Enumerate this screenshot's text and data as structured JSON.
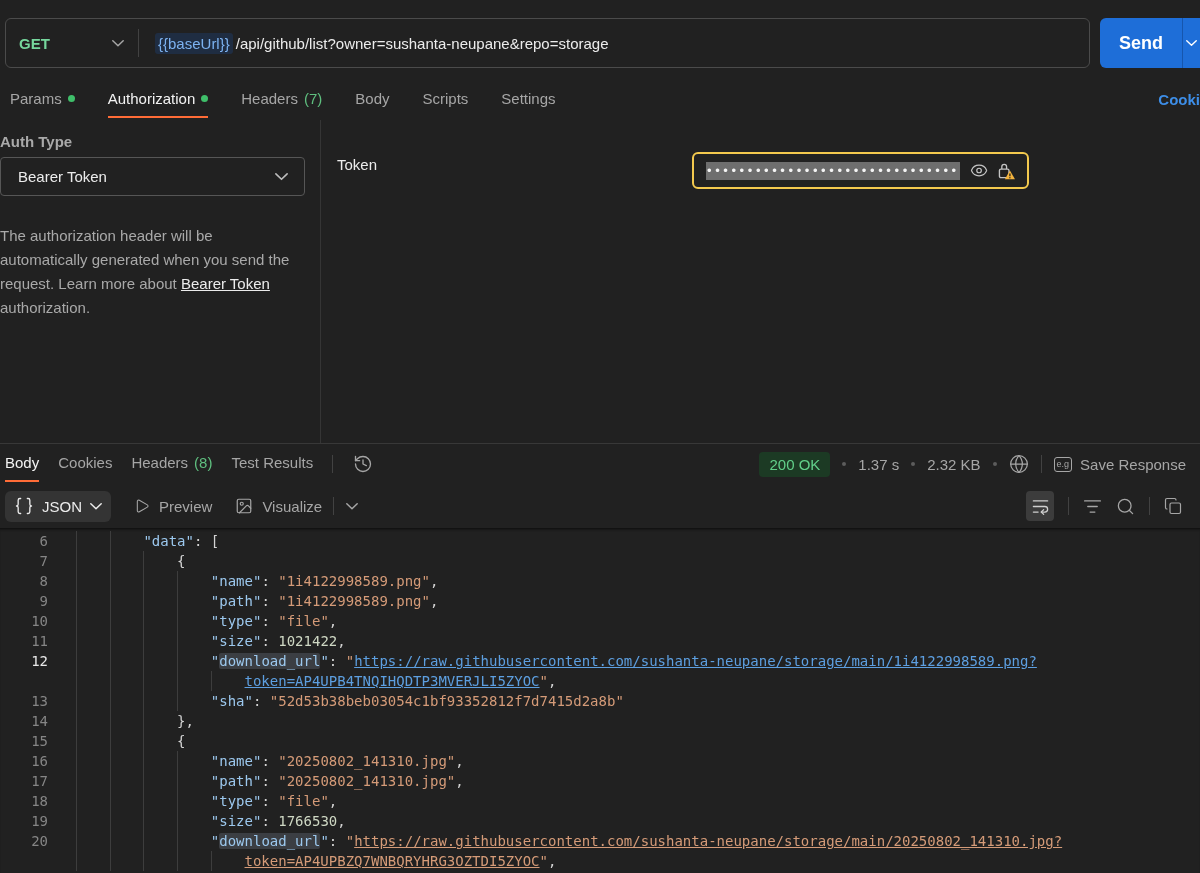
{
  "request": {
    "method": "GET",
    "url_variable": "{{baseUrl}}",
    "url_path": "/api/github/list?owner=sushanta-neupane&repo=storage",
    "send_label": "Send"
  },
  "request_tabs": [
    {
      "label": "Params",
      "dot": true,
      "selected": false
    },
    {
      "label": "Authorization",
      "dot": true,
      "selected": true
    },
    {
      "label": "Headers",
      "count": "(7)",
      "dot": false,
      "selected": false
    },
    {
      "label": "Body",
      "dot": false,
      "selected": false
    },
    {
      "label": "Scripts",
      "dot": false,
      "selected": false
    },
    {
      "label": "Settings",
      "dot": false,
      "selected": false
    }
  ],
  "cookies_link": "Cooki",
  "auth": {
    "type_label": "Auth Type",
    "type_value": "Bearer Token",
    "description_start": "The authorization header will be automatically generated when you send the request. Learn more about",
    "description_link": "Bearer Token",
    "description_end": "authorization."
  },
  "token": {
    "label": "Token",
    "value": "•••••••••••••••••••••••••••••••",
    "selected": true,
    "warning": true
  },
  "response_tabs": [
    {
      "label": "Body",
      "selected": true
    },
    {
      "label": "Cookies",
      "selected": false
    },
    {
      "label": "Headers",
      "count": "(8)",
      "selected": false
    },
    {
      "label": "Test Results",
      "selected": false
    }
  ],
  "response_status": {
    "status": "200 OK",
    "kind": "success",
    "time": "1.37 s",
    "size": "2.32 KB",
    "save_tag": "e.g",
    "save_label": "Save Response"
  },
  "body_view": {
    "format": "JSON",
    "views": [
      {
        "label": "Preview",
        "kind": "preview"
      },
      {
        "label": "Visualize",
        "kind": "visualize"
      }
    ],
    "wrap_on": true
  },
  "code": {
    "lines": [
      {
        "number": "6",
        "current": false,
        "tokens": [
          {
            "kind": "key",
            "text": "\"data\"",
            "highlighted": false
          },
          {
            "kind": "punct",
            "text": ": ["
          }
        ],
        "children": [
          {
            "number": "7",
            "current": false,
            "tokens": [
              {
                "kind": "punct",
                "text": "{"
              }
            ],
            "children": [
              {
                "number": "8",
                "current": false,
                "tokens": [
                  {
                    "kind": "key",
                    "text": "\"name\"",
                    "highlighted": false
                  },
                  {
                    "kind": "punct",
                    "text": ": "
                  },
                  {
                    "kind": "string",
                    "text": "\"1i4122998589.png\""
                  },
                  {
                    "kind": "punct",
                    "text": ","
                  }
                ]
              },
              {
                "number": "9",
                "current": false,
                "tokens": [
                  {
                    "kind": "key",
                    "text": "\"path\"",
                    "highlighted": false
                  },
                  {
                    "kind": "punct",
                    "text": ": "
                  },
                  {
                    "kind": "string",
                    "text": "\"1i4122998589.png\""
                  },
                  {
                    "kind": "punct",
                    "text": ","
                  }
                ]
              },
              {
                "number": "10",
                "current": false,
                "tokens": [
                  {
                    "kind": "key",
                    "text": "\"type\"",
                    "highlighted": false
                  },
                  {
                    "kind": "punct",
                    "text": ": "
                  },
                  {
                    "kind": "string",
                    "text": "\"file\""
                  },
                  {
                    "kind": "punct",
                    "text": ","
                  }
                ]
              },
              {
                "number": "11",
                "current": false,
                "tokens": [
                  {
                    "kind": "key",
                    "text": "\"size\"",
                    "highlighted": false
                  },
                  {
                    "kind": "punct",
                    "text": ": "
                  },
                  {
                    "kind": "number",
                    "text": "1021422"
                  },
                  {
                    "kind": "punct",
                    "text": ","
                  }
                ]
              },
              {
                "number": "12",
                "current": true,
                "tokens": [
                  {
                    "kind": "key",
                    "text": "\"",
                    "highlighted": false
                  },
                  {
                    "kind": "key",
                    "text": "download_url",
                    "highlighted": true
                  },
                  {
                    "kind": "key",
                    "text": "\"",
                    "highlighted": false
                  },
                  {
                    "kind": "punct",
                    "text": ": "
                  },
                  {
                    "kind": "string",
                    "text": "\""
                  },
                  {
                    "kind": "link",
                    "text": "https://raw.githubusercontent.com/sushanta-neupane/storage/main/1i4122998589.png?",
                    "hovered": true
                  }
                ],
                "continuation": [
                  {
                    "kind": "link",
                    "text": "token=AP4UPB4TNQIHQDTP3MVERJLI5ZYOC",
                    "hovered": true
                  },
                  {
                    "kind": "string",
                    "text": "\""
                  },
                  {
                    "kind": "punct",
                    "text": ","
                  }
                ]
              },
              {
                "number": "13",
                "current": false,
                "tokens": [
                  {
                    "kind": "key",
                    "text": "\"sha\"",
                    "highlighted": false
                  },
                  {
                    "kind": "punct",
                    "text": ": "
                  },
                  {
                    "kind": "string",
                    "text": "\"52d53b38beb03054c1bf93352812f7d7415d2a8b\""
                  }
                ]
              }
            ]
          },
          {
            "number": "14",
            "current": false,
            "tokens": [
              {
                "kind": "punct",
                "text": "},"
              }
            ]
          },
          {
            "number": "15",
            "current": false,
            "tokens": [
              {
                "kind": "punct",
                "text": "{"
              }
            ],
            "children": [
              {
                "number": "16",
                "current": false,
                "tokens": [
                  {
                    "kind": "key",
                    "text": "\"name\"",
                    "highlighted": false
                  },
                  {
                    "kind": "punct",
                    "text": ": "
                  },
                  {
                    "kind": "string",
                    "text": "\"20250802_141310.jpg\""
                  },
                  {
                    "kind": "punct",
                    "text": ","
                  }
                ]
              },
              {
                "number": "17",
                "current": false,
                "tokens": [
                  {
                    "kind": "key",
                    "text": "\"path\"",
                    "highlighted": false
                  },
                  {
                    "kind": "punct",
                    "text": ": "
                  },
                  {
                    "kind": "string",
                    "text": "\"20250802_141310.jpg\""
                  },
                  {
                    "kind": "punct",
                    "text": ","
                  }
                ]
              },
              {
                "number": "18",
                "current": false,
                "tokens": [
                  {
                    "kind": "key",
                    "text": "\"type\"",
                    "highlighted": false
                  },
                  {
                    "kind": "punct",
                    "text": ": "
                  },
                  {
                    "kind": "string",
                    "text": "\"file\""
                  },
                  {
                    "kind": "punct",
                    "text": ","
                  }
                ]
              },
              {
                "number": "19",
                "current": false,
                "tokens": [
                  {
                    "kind": "key",
                    "text": "\"size\"",
                    "highlighted": false
                  },
                  {
                    "kind": "punct",
                    "text": ": "
                  },
                  {
                    "kind": "number",
                    "text": "1766530"
                  },
                  {
                    "kind": "punct",
                    "text": ","
                  }
                ]
              },
              {
                "number": "20",
                "current": false,
                "tokens": [
                  {
                    "kind": "key",
                    "text": "\"",
                    "highlighted": false
                  },
                  {
                    "kind": "key",
                    "text": "download_url",
                    "highlighted": true
                  },
                  {
                    "kind": "key",
                    "text": "\"",
                    "highlighted": false
                  },
                  {
                    "kind": "punct",
                    "text": ": "
                  },
                  {
                    "kind": "string",
                    "text": "\""
                  },
                  {
                    "kind": "link",
                    "text": "https://raw.githubusercontent.com/sushanta-neupane/storage/main/20250802_141310.jpg?",
                    "hovered": false
                  }
                ],
                "continuation": [
                  {
                    "kind": "link",
                    "text": "token=AP4UPBZQ7WNBQRYHRG3OZTDI5ZYOC",
                    "hovered": false
                  },
                  {
                    "kind": "string",
                    "text": "\""
                  },
                  {
                    "kind": "punct",
                    "text": ","
                  }
                ]
              }
            ]
          }
        ]
      }
    ]
  }
}
